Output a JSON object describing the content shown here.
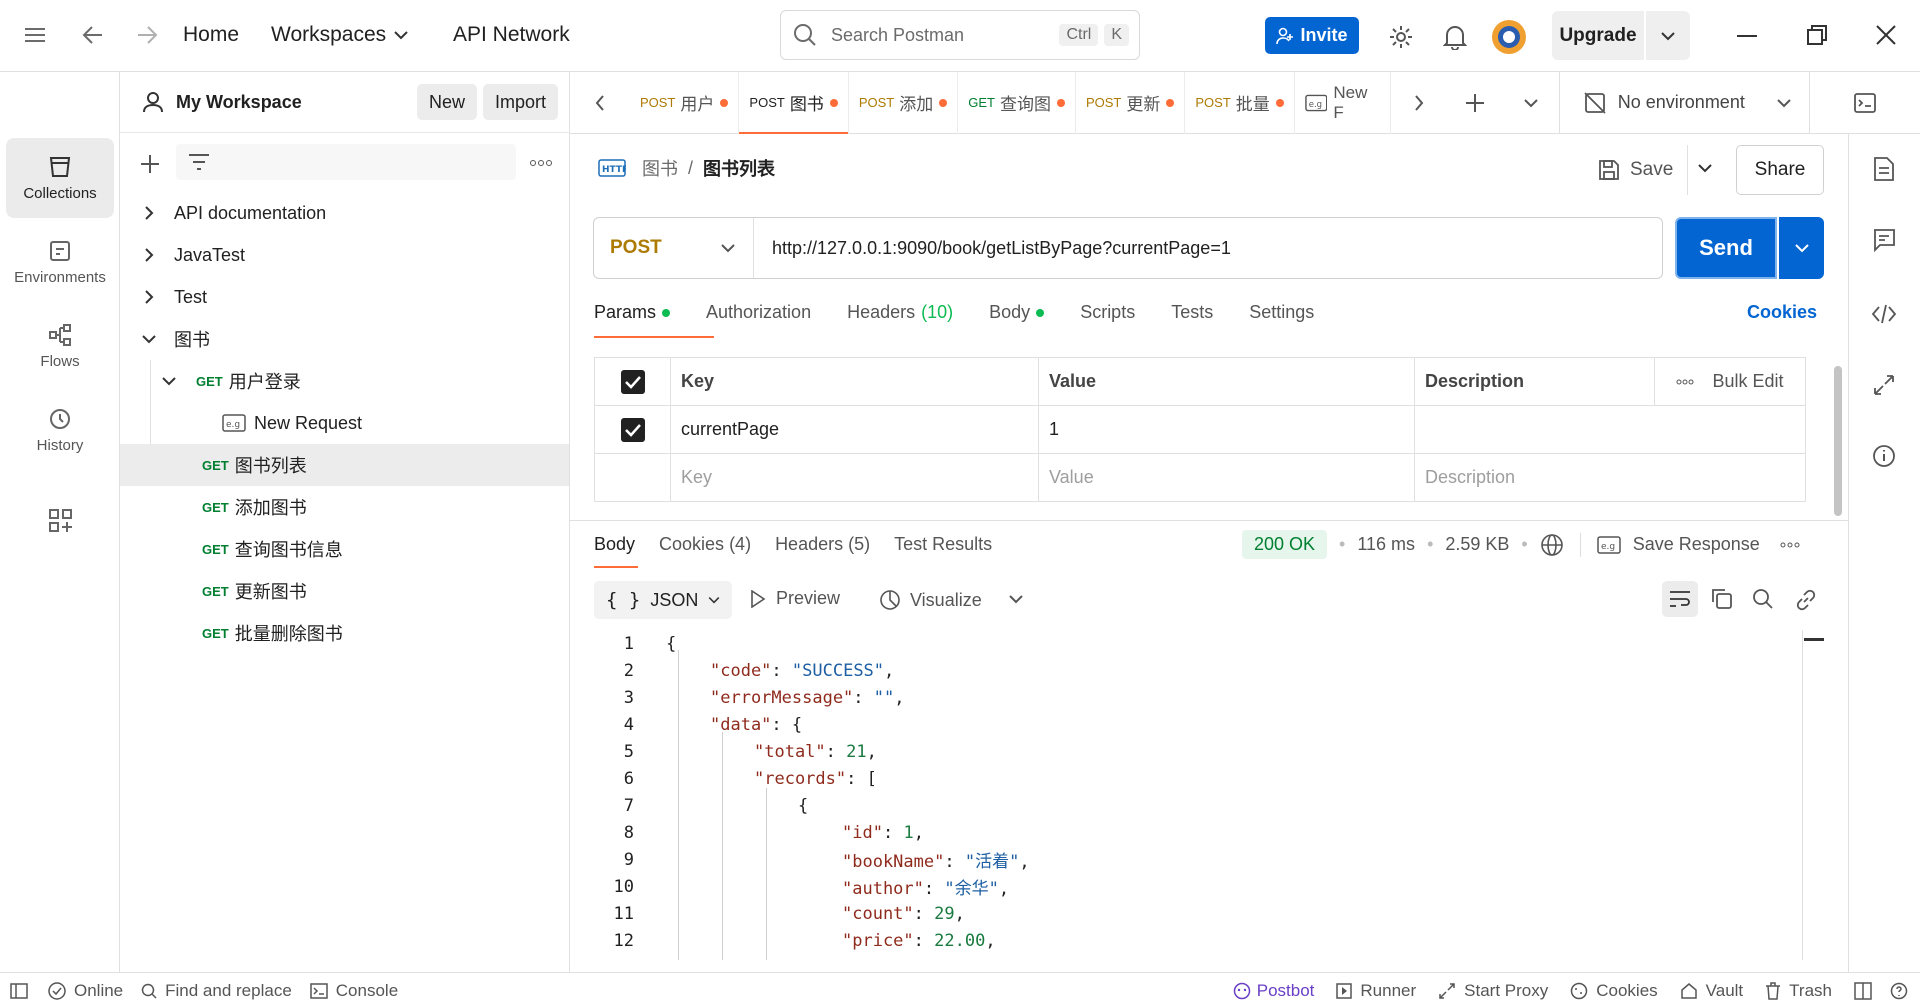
{
  "topbar": {
    "home": "Home",
    "workspaces": "Workspaces",
    "api_network": "API Network",
    "search_placeholder": "Search Postman",
    "kbd_ctrl": "Ctrl",
    "kbd_k": "K",
    "invite": "Invite",
    "upgrade": "Upgrade"
  },
  "rail": {
    "collections": "Collections",
    "environments": "Environments",
    "flows": "Flows",
    "history": "History"
  },
  "sidebar": {
    "workspace": "My Workspace",
    "new": "New",
    "import": "Import",
    "items": [
      {
        "label": "API documentation"
      },
      {
        "label": "JavaTest"
      },
      {
        "label": "Test"
      },
      {
        "label": "图书"
      },
      {
        "method": "GET",
        "label": "用户登录"
      },
      {
        "label": "New Request"
      },
      {
        "method": "GET",
        "label": "图书列表"
      },
      {
        "method": "GET",
        "label": "添加图书"
      },
      {
        "method": "GET",
        "label": "查询图书信息"
      },
      {
        "method": "GET",
        "label": "更新图书"
      },
      {
        "method": "GET",
        "label": "批量删除图书"
      }
    ]
  },
  "tabs": [
    {
      "method": "POST",
      "label": "用户"
    },
    {
      "method": "POST",
      "label": "图书"
    },
    {
      "method": "POST",
      "label": "添加"
    },
    {
      "method": "GET",
      "label": "查询图"
    },
    {
      "method": "POST",
      "label": "更新"
    },
    {
      "method": "POST",
      "label": "批量"
    },
    {
      "method": "",
      "label": "New F"
    }
  ],
  "environment": "No environment",
  "request": {
    "breadcrumb_parent": "图书",
    "breadcrumb_sep": "/",
    "title": "图书列表",
    "save": "Save",
    "share": "Share",
    "method": "POST",
    "url": "http://127.0.0.1:9090/book/getListByPage?currentPage=1",
    "send": "Send",
    "subtabs": {
      "params": "Params",
      "authorization": "Authorization",
      "headers": "Headers",
      "headers_count": "(10)",
      "body": "Body",
      "scripts": "Scripts",
      "tests": "Tests",
      "settings": "Settings",
      "cookies": "Cookies"
    },
    "params_table": {
      "key_header": "Key",
      "value_header": "Value",
      "desc_header": "Description",
      "bulk_edit": "Bulk Edit",
      "row_key": "currentPage",
      "row_value": "1",
      "ph_key": "Key",
      "ph_value": "Value",
      "ph_desc": "Description"
    }
  },
  "response": {
    "tabs": {
      "body": "Body",
      "cookies": "Cookies (4)",
      "headers": "Headers (5)",
      "test_results": "Test Results"
    },
    "status": "200 OK",
    "time": "116 ms",
    "size": "2.59 KB",
    "save_response": "Save Response",
    "format": "JSON",
    "preview": "Preview",
    "visualize": "Visualize",
    "lines": [
      "{",
      "\"code\": \"SUCCESS\",",
      "\"errorMessage\": \"\",",
      "\"data\": {",
      "\"total\": 21,",
      "\"records\": [",
      "{",
      "\"id\": 1,",
      "\"bookName\": \"活着\",",
      "\"author\": \"余华\",",
      "\"count\": 29,",
      "\"price\": 22.00,"
    ]
  },
  "statusbar": {
    "online": "Online",
    "find_replace": "Find and replace",
    "console": "Console",
    "postbot": "Postbot",
    "runner": "Runner",
    "start_proxy": "Start Proxy",
    "cookies": "Cookies",
    "vault": "Vault",
    "trash": "Trash"
  }
}
